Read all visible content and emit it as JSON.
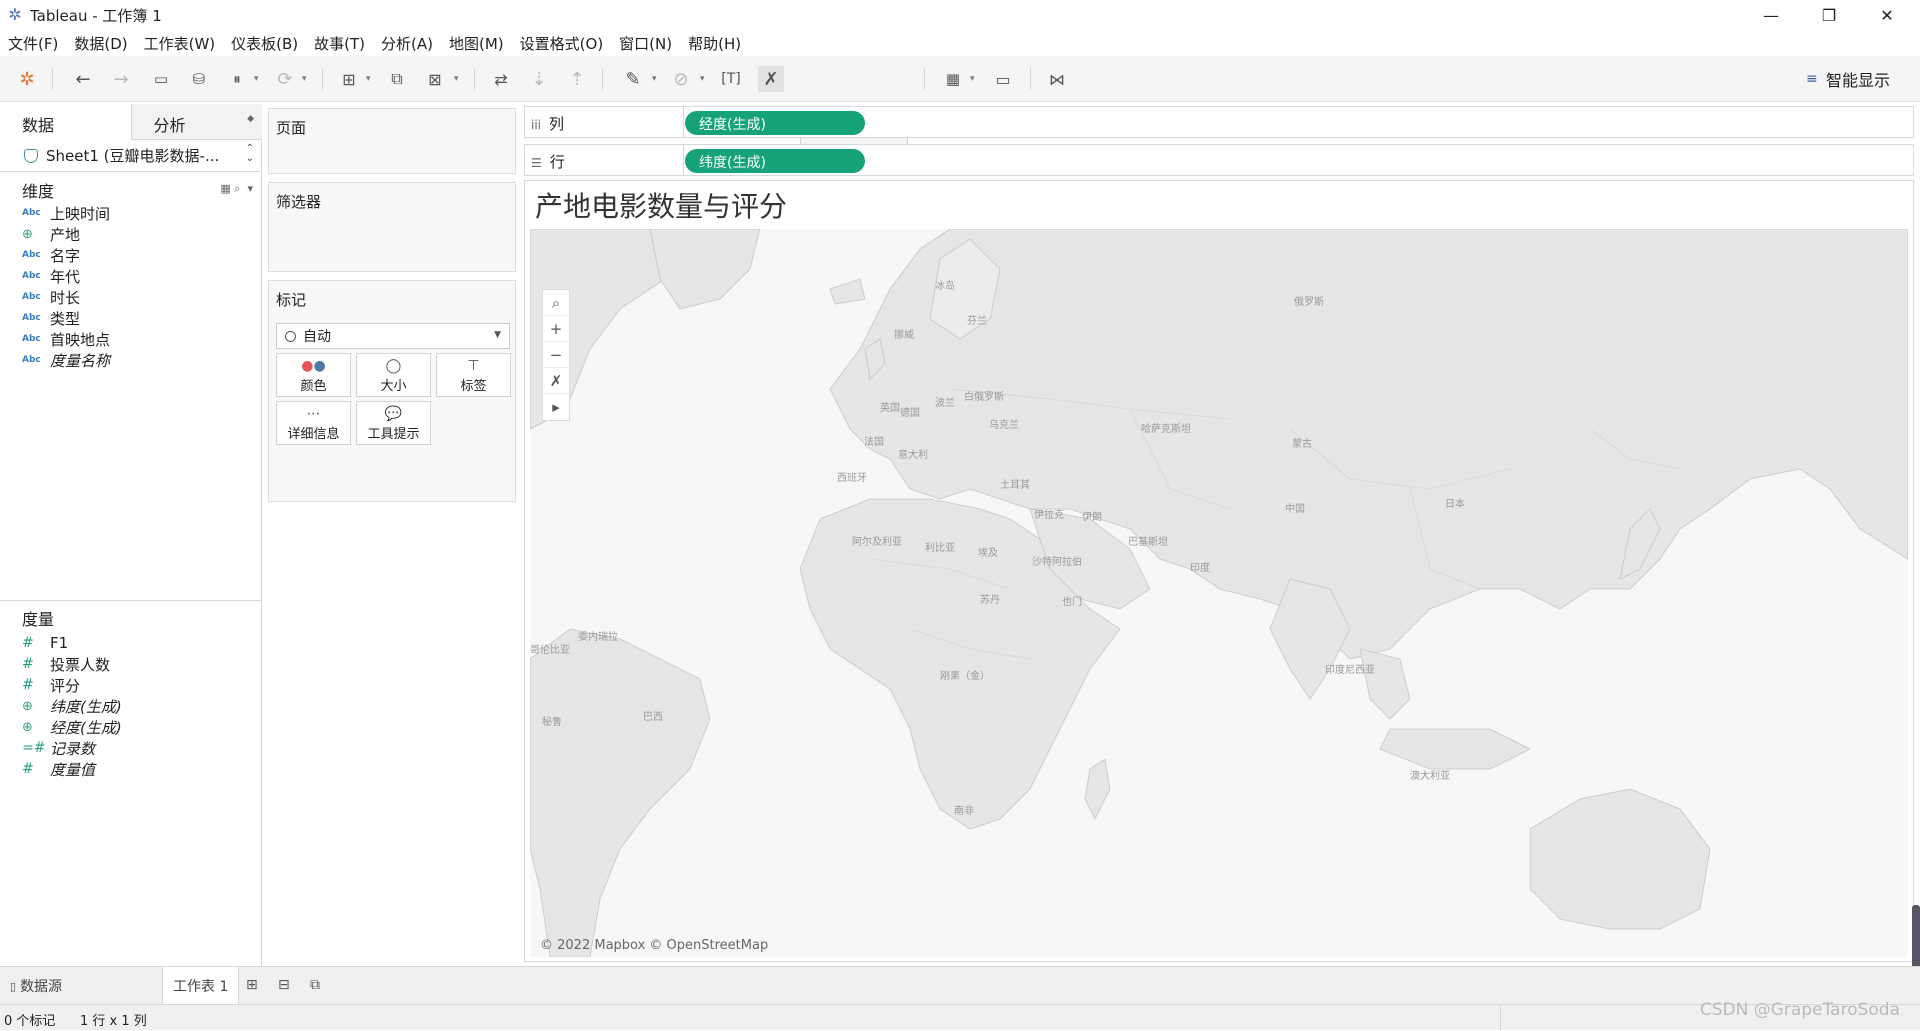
{
  "app": {
    "title": "Tableau - 工作簿 1"
  },
  "menu": [
    "文件(F)",
    "数据(D)",
    "工作表(W)",
    "仪表板(B)",
    "故事(T)",
    "分析(A)",
    "地图(M)",
    "设置格式(O)",
    "窗口(N)",
    "帮助(H)"
  ],
  "toolbar": {
    "show_me": "智能显示"
  },
  "data_pane": {
    "tab_data": "数据",
    "tab_analysis": "分析",
    "datasource": "Sheet1 (豆瓣电影数据-...",
    "dimensions_header": "维度",
    "dimensions": [
      {
        "type": "Abc",
        "label": "上映时间"
      },
      {
        "type": "geo",
        "label": "产地"
      },
      {
        "type": "Abc",
        "label": "名字"
      },
      {
        "type": "Abc",
        "label": "年代"
      },
      {
        "type": "Abc",
        "label": "时长"
      },
      {
        "type": "Abc",
        "label": "类型"
      },
      {
        "type": "Abc",
        "label": "首映地点"
      },
      {
        "type": "Abc",
        "label": "度量名称"
      }
    ],
    "measures_header": "度量",
    "measures": [
      {
        "type": "#",
        "label": "F1"
      },
      {
        "type": "#",
        "label": "投票人数"
      },
      {
        "type": "#",
        "label": "评分"
      },
      {
        "type": "geo",
        "label": "纬度(生成)"
      },
      {
        "type": "geo",
        "label": "经度(生成)"
      },
      {
        "type": "=#",
        "label": "记录数"
      },
      {
        "type": "#",
        "label": "度量值"
      }
    ]
  },
  "cards": {
    "pages": "页面",
    "filters": "筛选器",
    "marks": "标记",
    "mark_type": "自动",
    "buttons": [
      "颜色",
      "大小",
      "标签",
      "详细信息",
      "工具提示"
    ]
  },
  "shelves": {
    "columns_label": "列",
    "columns_pill": "经度(生成)",
    "rows_label": "行",
    "rows_pill": "纬度(生成)"
  },
  "view": {
    "title": "产地电影数量与评分",
    "attribution": "© 2022 Mapbox © OpenStreetMap",
    "map_labels": [
      "俄罗斯",
      "冰岛",
      "芬兰",
      "挪威",
      "白俄罗斯",
      "英国",
      "波兰",
      "德国",
      "乌克兰",
      "法国",
      "意大利",
      "西班牙",
      "哈萨克斯坦",
      "蒙古",
      "土耳其",
      "阿尔及利亚",
      "利比亚",
      "埃及",
      "伊拉克",
      "伊朗",
      "巴基斯坦",
      "沙特阿拉伯",
      "中国",
      "日本",
      "印度",
      "苏丹",
      "也门",
      "刚果（金）",
      "哥伦比亚",
      "秘鲁",
      "巴西",
      "印度尼西亚",
      "澳大利亚",
      "南非",
      "委内瑞拉"
    ]
  },
  "sheetbar": {
    "datasource": "数据源",
    "sheet": "工作表 1"
  },
  "status": {
    "marks": "0 个标记",
    "rows_cols": "1 行 x 1 列"
  },
  "watermark": "CSDN @GrapeTaroSoda"
}
